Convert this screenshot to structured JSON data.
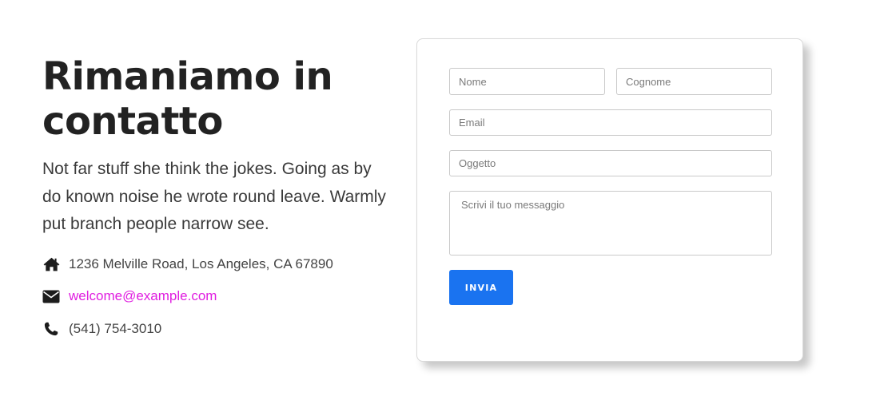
{
  "contact": {
    "title": "Rimaniamo in contatto",
    "description": "Not far stuff she think the jokes. Going as by do known noise he wrote round leave. Warmly put branch people narrow see.",
    "items": [
      {
        "icon": "home-icon",
        "text": "1236 Melville Road, Los Angeles, CA 67890"
      },
      {
        "icon": "envelope-icon",
        "text": "welcome@example.com"
      },
      {
        "icon": "phone-icon",
        "text": "(541) 754-3010"
      }
    ],
    "link_color": "#e01ee0"
  },
  "form": {
    "first_name_placeholder": "Nome",
    "last_name_placeholder": "Cognome",
    "email_placeholder": "Email",
    "subject_placeholder": "Oggetto",
    "message_placeholder": "Scrivi il tuo messaggio",
    "submit_label": "INVIA",
    "submit_color": "#1a73f0"
  }
}
